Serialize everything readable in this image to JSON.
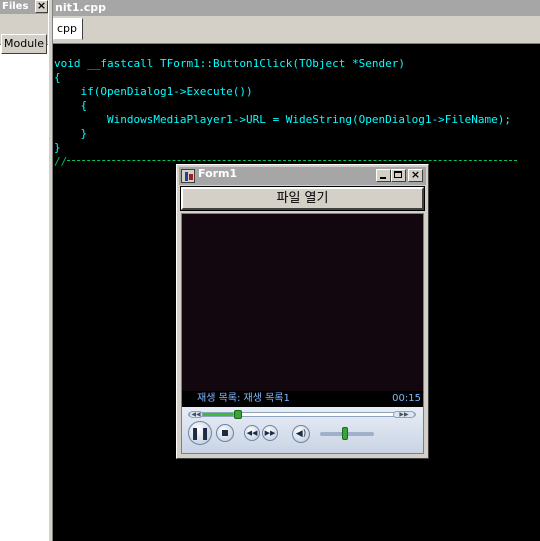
{
  "left_panel": {
    "title": "Files",
    "close_glyph": "×",
    "module_tab": "Module"
  },
  "editor": {
    "title": "nit1.cpp",
    "file_tab": "cpp",
    "code_lines": [
      "void __fastcall TForm1::Button1Click(TObject *Sender)",
      "{",
      "    if(OpenDialog1->Execute())",
      "    {",
      "        WindowsMediaPlayer1->URL = WideString(OpenDialog1->FileName);",
      "    }",
      "}",
      "//"
    ],
    "code_color": "#00ffff",
    "comment_color": "#00c060"
  },
  "form1": {
    "title": "Form1",
    "close_glyph": "×",
    "open_file_button": "파일 열기"
  },
  "player": {
    "playlist_label": "재생 목록: 재생 목록1",
    "time": "00:15",
    "seek_position": 0.15,
    "volume_level": 0.45,
    "icons": {
      "pause": "pause-icon",
      "stop": "stop-icon",
      "previous": "previous-icon",
      "next": "next-icon",
      "mute": "speaker-icon"
    },
    "pause_glyph": "❚❚",
    "prev_glyph": "◀◀",
    "next_glyph": "▶▶",
    "mute_glyph": "◀)",
    "seek_left_glyph": "◀◀",
    "seek_right_glyph": "▶▶"
  }
}
